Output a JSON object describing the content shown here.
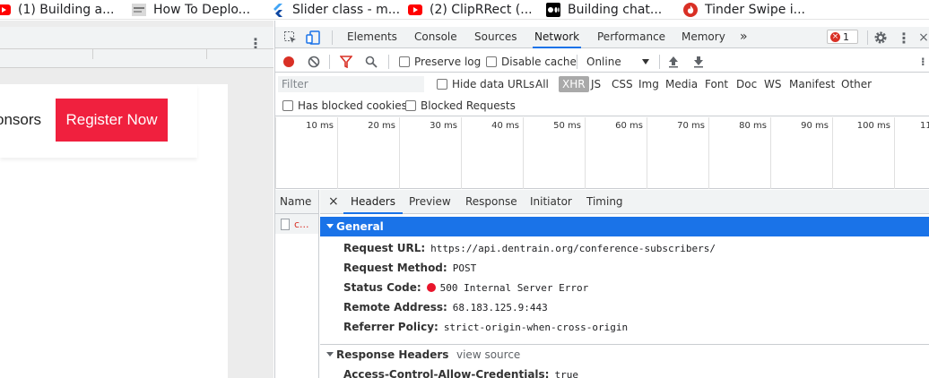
{
  "bookmarks": [
    {
      "label": "(1) Building a...",
      "icon": "youtube-icon",
      "color": "#ff0000"
    },
    {
      "label": "How To Deplo...",
      "icon": "page-favicon-icon",
      "color": "#888888"
    },
    {
      "label": "Slider class - m...",
      "icon": "flutter-icon",
      "color": "#42a5f5"
    },
    {
      "label": "(2) ClipRRect (...",
      "icon": "youtube-icon",
      "color": "#ff0000"
    },
    {
      "label": "Building chat...",
      "icon": "medium-icon",
      "color": "#000000"
    },
    {
      "label": "Tinder Swipe i...",
      "icon": "tinder-icon",
      "color": "#d93025"
    }
  ],
  "page": {
    "nav_link": "onsors",
    "register_button": "Register Now",
    "accent_color": "#f0203e"
  },
  "devtools": {
    "tabs": [
      "Elements",
      "Console",
      "Sources",
      "Network",
      "Performance",
      "Memory"
    ],
    "active_tab": "Network",
    "more_tabs": "»",
    "error_count": "1",
    "toolbar": {
      "preserve_log": "Preserve log",
      "disable_cache": "Disable cache",
      "throttle": "Online"
    },
    "filter": {
      "placeholder": "Filter",
      "hide_data_urls": "Hide data URLs",
      "types": [
        "All",
        "XHR",
        "JS",
        "CSS",
        "Img",
        "Media",
        "Font",
        "Doc",
        "WS",
        "Manifest",
        "Other"
      ],
      "selected_type": "XHR",
      "has_blocked_cookies": "Has blocked cookies",
      "blocked_requests": "Blocked Requests"
    },
    "timeline_ticks": [
      "10 ms",
      "20 ms",
      "30 ms",
      "40 ms",
      "50 ms",
      "60 ms",
      "70 ms",
      "80 ms",
      "90 ms",
      "100 ms",
      "11"
    ],
    "requests": {
      "column": "Name",
      "rows": [
        "c..."
      ]
    },
    "detail": {
      "close": "×",
      "tabs": [
        "Headers",
        "Preview",
        "Response",
        "Initiator",
        "Timing"
      ],
      "active_tab": "Headers",
      "general_title": "General",
      "fields": [
        {
          "key": "Request URL:",
          "value": "https://api.dentrain.org/conference-subscribers/"
        },
        {
          "key": "Request Method:",
          "value": "POST"
        },
        {
          "key": "Status Code:",
          "value": "500 Internal Server Error"
        },
        {
          "key": "Remote Address:",
          "value": "68.183.125.9:443"
        },
        {
          "key": "Referrer Policy:",
          "value": "strict-origin-when-cross-origin"
        }
      ],
      "response_headers_title": "Response Headers",
      "view_source": "view source",
      "next_field": {
        "key": "Access-Control-Allow-Credentials:",
        "value": "true"
      }
    }
  }
}
